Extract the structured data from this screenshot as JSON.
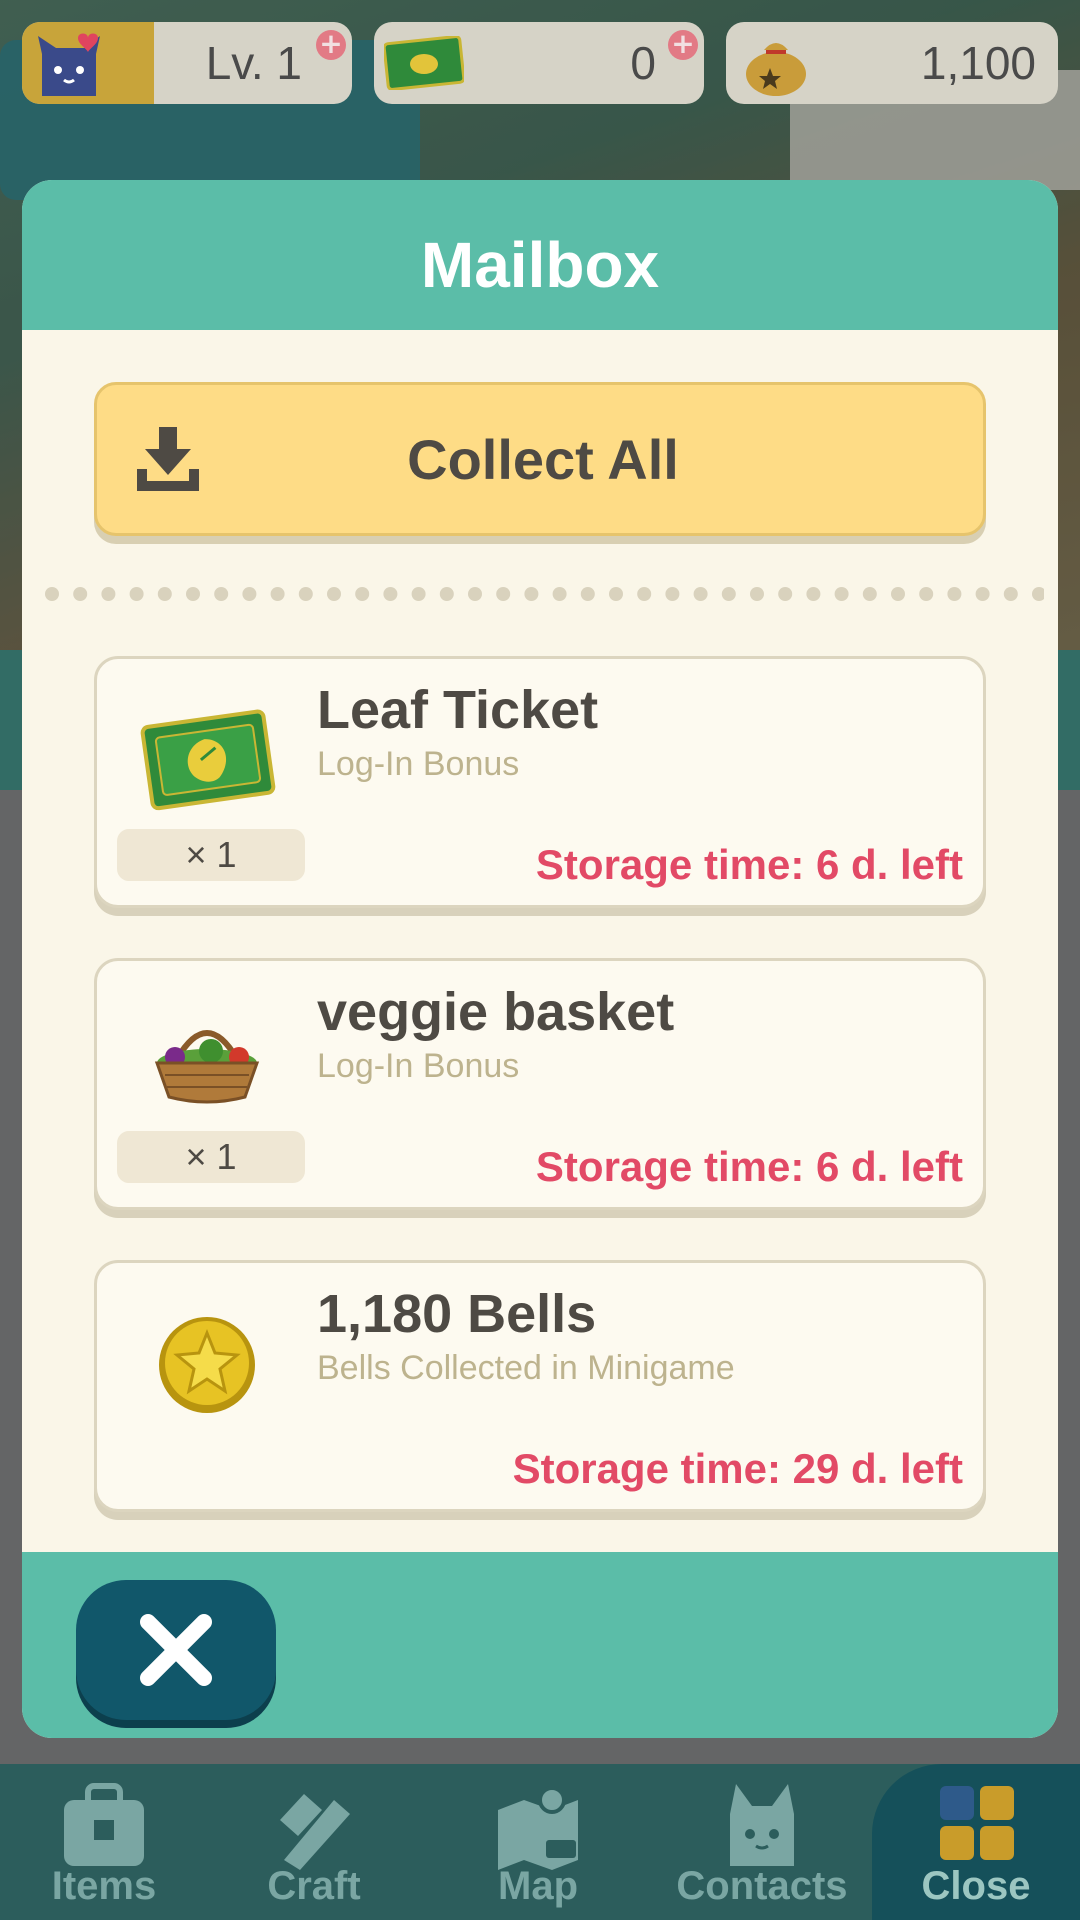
{
  "hud": {
    "level_text": "Lv. 1",
    "leaf_tickets": "0",
    "bells": "1,100"
  },
  "modal": {
    "title": "Mailbox",
    "collect_all_label": "Collect All",
    "items": [
      {
        "name": "Leaf Ticket",
        "source": "Log-In Bonus",
        "quantity": "× 1",
        "storage": "Storage time: 6 d. left",
        "icon": "leaf-ticket-icon"
      },
      {
        "name": "veggie basket",
        "source": "Log-In Bonus",
        "quantity": "× 1",
        "storage": "Storage time: 6 d. left",
        "icon": "veggie-basket-icon"
      },
      {
        "name": "1,180 Bells",
        "source": "Bells Collected in Minigame",
        "quantity": "",
        "storage": "Storage time: 29 d. left",
        "icon": "bell-coin-icon"
      }
    ]
  },
  "nav": {
    "items_label": "Items",
    "craft_label": "Craft",
    "map_label": "Map",
    "contacts_label": "Contacts",
    "close_label": "Close"
  },
  "colors": {
    "teal": "#5bbda8",
    "cream": "#faf6e8",
    "button_yellow": "#fedc86",
    "storage_red": "#e24a66",
    "nav_bg": "#2c5d5c",
    "close_button": "#11576a"
  }
}
